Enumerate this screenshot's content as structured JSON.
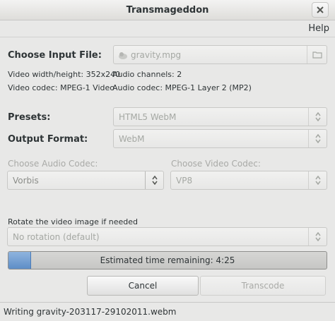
{
  "window": {
    "title": "Transmageddon"
  },
  "menu": {
    "help": "Help"
  },
  "input": {
    "label": "Choose Input File:",
    "file": "gravity.mpg",
    "video_size": "Video width/height: 352x240",
    "video_codec": "Video codec: MPEG-1 Video",
    "audio_channels": "Audio channels: 2",
    "audio_codec": "Audio codec: MPEG-1 Layer 2 (MP2)"
  },
  "presets": {
    "label": "Presets:",
    "value": "HTML5 WebM"
  },
  "output_format": {
    "label": "Output Format:",
    "value": "WebM"
  },
  "audio_codec": {
    "label": "Choose Audio Codec:",
    "value": "Vorbis"
  },
  "video_codec": {
    "label": "Choose Video Codec:",
    "value": "VP8"
  },
  "rotation": {
    "label": "Rotate the video image if needed",
    "value": "No rotation (default)"
  },
  "progress": {
    "text": "Estimated time remaining: 4:25",
    "fraction": 0.07
  },
  "buttons": {
    "cancel": "Cancel",
    "transcode": "Transcode"
  },
  "status": {
    "text": "Writing gravity-203117-29102011.webm"
  },
  "icons": {
    "close": "close-icon",
    "file": "audio-file-icon",
    "folder": "folder-icon",
    "arrows": "up-down-arrows-icon"
  }
}
